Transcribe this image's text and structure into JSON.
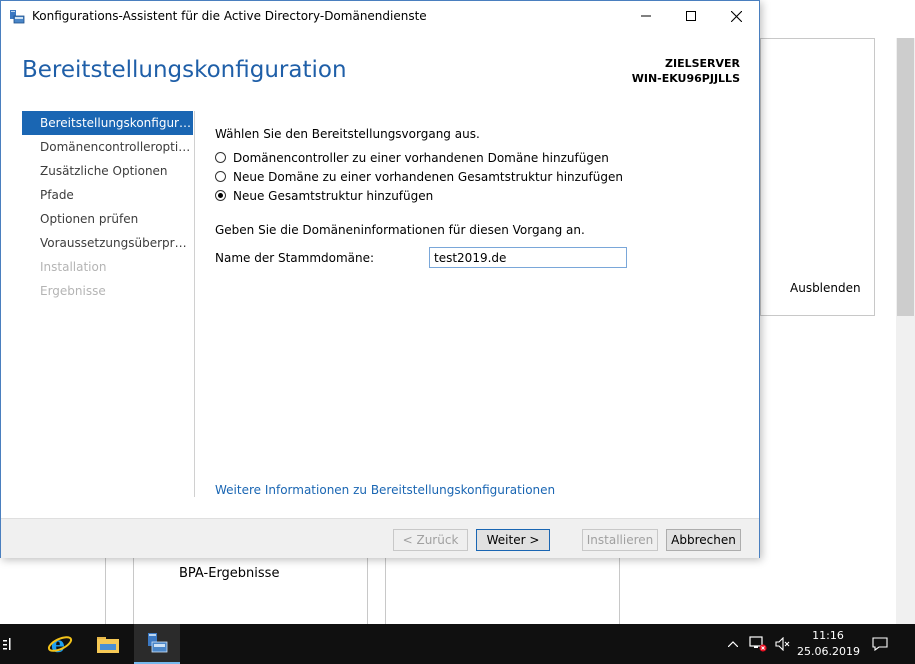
{
  "background": {
    "hide_label": "Ausblenden",
    "bpa_label": "BPA-Ergebnisse"
  },
  "window": {
    "title": "Konfigurations-Assistent für die Active Directory-Domänendienste",
    "page_title": "Bereitstellungskonfiguration",
    "target_label": "ZIELSERVER",
    "target_server": "WIN-EKU96PJJLLS"
  },
  "nav": {
    "items": [
      {
        "label": "Bereitstellungskonfigurati...",
        "state": "active"
      },
      {
        "label": "Domänencontrolleroption...",
        "state": "normal"
      },
      {
        "label": "Zusätzliche Optionen",
        "state": "normal"
      },
      {
        "label": "Pfade",
        "state": "normal"
      },
      {
        "label": "Optionen prüfen",
        "state": "normal"
      },
      {
        "label": "Voraussetzungsüberprüfu...",
        "state": "normal"
      },
      {
        "label": "Installation",
        "state": "disabled"
      },
      {
        "label": "Ergebnisse",
        "state": "disabled"
      }
    ]
  },
  "content": {
    "select_prompt": "Wählen Sie den Bereitstellungsvorgang aus.",
    "options": [
      {
        "label": "Domänencontroller zu einer vorhandenen Domäne hinzufügen",
        "checked": false
      },
      {
        "label": "Neue Domäne zu einer vorhandenen Gesamtstruktur hinzufügen",
        "checked": false
      },
      {
        "label": "Neue Gesamtstruktur hinzufügen",
        "checked": true
      }
    ],
    "domain_prompt": "Geben Sie die Domäneninformationen für diesen Vorgang an.",
    "root_domain_label": "Name der Stammdomäne:",
    "root_domain_value": "test2019.de",
    "more_info_link": "Weitere Informationen zu Bereitstellungskonfigurationen"
  },
  "footer": {
    "back_label": "< Zurück",
    "next_label": "Weiter >",
    "install_label": "Installieren",
    "cancel_label": "Abbrechen"
  },
  "taskbar": {
    "time": "11:16",
    "date": "25.06.2019"
  },
  "colors": {
    "accent": "#1a66b3",
    "title_blue": "#1f5fa8",
    "taskbar": "#101010"
  }
}
